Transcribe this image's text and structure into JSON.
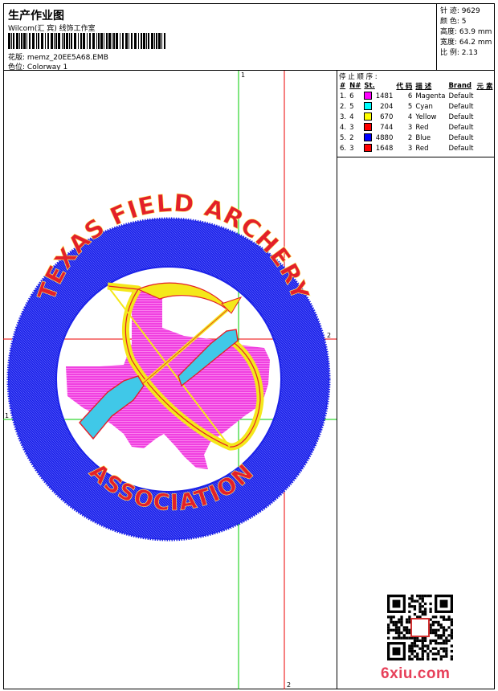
{
  "header": {
    "title": "生产作业图",
    "software": "Wilcom(汇 宾) 线饰工作室",
    "design_file_label": "花版:",
    "design_file": "memz_20EE5A68.EMB",
    "colorway_label": "色位:",
    "colorway": "Colorway 1"
  },
  "stats": {
    "stitches_label": "针 迹:",
    "stitches": "9629",
    "colors_label": "颜 色:",
    "colors": "5",
    "height_label": "高度:",
    "height": "63.9 mm",
    "width_label": "宽度:",
    "width": "64.2 mm",
    "scale_label": "比 例:",
    "scale": "2.13"
  },
  "sequence": {
    "label": "停 止 顺 序 :",
    "headers": [
      "#",
      "N#",
      "St.",
      "代 码",
      "描 述",
      "Brand",
      "元 素"
    ],
    "rows": [
      {
        "idx": "1.",
        "n": "6",
        "color": "#ff00ff",
        "st": "1481",
        "code": "6",
        "desc": "Magenta",
        "brand": "Default"
      },
      {
        "idx": "2.",
        "n": "5",
        "color": "#00ffff",
        "st": "204",
        "code": "5",
        "desc": "Cyan",
        "brand": "Default"
      },
      {
        "idx": "3.",
        "n": "4",
        "color": "#ffff00",
        "st": "670",
        "code": "4",
        "desc": "Yellow",
        "brand": "Default"
      },
      {
        "idx": "4.",
        "n": "3",
        "color": "#ff0000",
        "st": "744",
        "code": "3",
        "desc": "Red",
        "brand": "Default"
      },
      {
        "idx": "5.",
        "n": "2",
        "color": "#0000ff",
        "st": "4880",
        "code": "2",
        "desc": "Blue",
        "brand": "Default"
      },
      {
        "idx": "6.",
        "n": "3",
        "color": "#ff0000",
        "st": "1648",
        "code": "3",
        "desc": "Red",
        "brand": "Default"
      }
    ]
  },
  "design": {
    "top_text": "TEXAS FIELD ARCHERY",
    "bottom_text": "ASSOCIATION",
    "colors": {
      "ring": "#1c22e8",
      "lettering": "#e3202a",
      "state": "#f040e0",
      "bow": "#f4e81a",
      "fletch": "#40c8e8",
      "guide_green": "#00cc00",
      "guide_red": "#ee0000"
    },
    "markers": {
      "m1_top": "1",
      "m1_left": "1",
      "m2_right": "2",
      "m2_bottom": "2"
    }
  },
  "watermark": {
    "text": "6xiu.com"
  }
}
